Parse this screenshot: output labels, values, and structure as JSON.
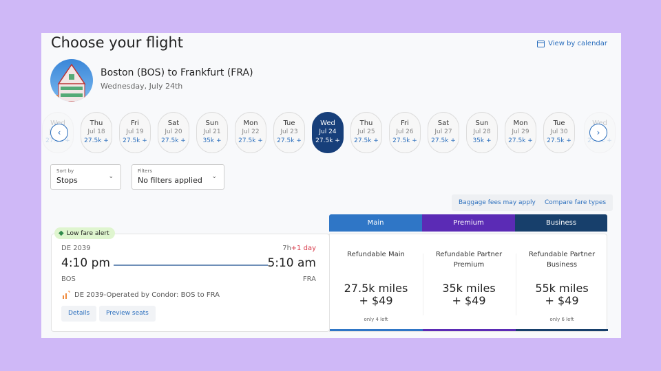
{
  "header": {
    "title": "Choose your flight",
    "view_calendar": "View by calendar",
    "route": "Boston (BOS) to Frankfurt (FRA)",
    "date": "Wednesday, July 24th"
  },
  "dates": [
    {
      "day": "Wed",
      "date": "Jul 17",
      "price": "27.5k +",
      "state": "partial"
    },
    {
      "day": "Thu",
      "date": "Jul 18",
      "price": "27.5k +"
    },
    {
      "day": "Fri",
      "date": "Jul 19",
      "price": "27.5k +"
    },
    {
      "day": "Sat",
      "date": "Jul 20",
      "price": "27.5k +"
    },
    {
      "day": "Sun",
      "date": "Jul 21",
      "price": "35k +"
    },
    {
      "day": "Mon",
      "date": "Jul 22",
      "price": "27.5k +"
    },
    {
      "day": "Tue",
      "date": "Jul 23",
      "price": "27.5k +"
    },
    {
      "day": "Wed",
      "date": "Jul 24",
      "price": "27.5k +",
      "state": "selected"
    },
    {
      "day": "Thu",
      "date": "Jul 25",
      "price": "27.5k +"
    },
    {
      "day": "Fri",
      "date": "Jul 26",
      "price": "27.5k +"
    },
    {
      "day": "Sat",
      "date": "Jul 27",
      "price": "27.5k +"
    },
    {
      "day": "Sun",
      "date": "Jul 28",
      "price": "35k +"
    },
    {
      "day": "Mon",
      "date": "Jul 29",
      "price": "27.5k +"
    },
    {
      "day": "Tue",
      "date": "Jul 30",
      "price": "27.5k +"
    },
    {
      "day": "Wed",
      "date": "Jul 31",
      "price": "27.5k +",
      "state": "partial"
    }
  ],
  "sort": {
    "label": "Sort by",
    "value": "Stops"
  },
  "filters": {
    "label": "Filters",
    "value": "No filters applied"
  },
  "links": {
    "baggage": "Baggage fees may apply",
    "compare": "Compare fare types"
  },
  "cabins": [
    {
      "label": "Main",
      "color": "#2f76c6"
    },
    {
      "label": "Premium",
      "color": "#5b2bb5"
    },
    {
      "label": "Business",
      "color": "#173f6b"
    }
  ],
  "flight": {
    "badge": "Low fare alert",
    "number": "DE 2039",
    "duration": "7h",
    "day_offset": "+1 day",
    "depart_time": "4:10 pm",
    "arrive_time": "5:10 am",
    "origin": "BOS",
    "destination": "FRA",
    "operated": "DE 2039-Operated by Condor: BOS to FRA",
    "details": "Details",
    "preview": "Preview seats"
  },
  "fares": [
    {
      "name": "Refundable Main",
      "miles": "27.5k miles",
      "cash": "+ $49",
      "seats": "only 4 left"
    },
    {
      "name": "Refundable Partner Premium",
      "miles": "35k miles",
      "cash": "+ $49",
      "seats": ""
    },
    {
      "name": "Refundable Partner Business",
      "miles": "55k miles",
      "cash": "+ $49",
      "seats": "only 6 left"
    }
  ]
}
